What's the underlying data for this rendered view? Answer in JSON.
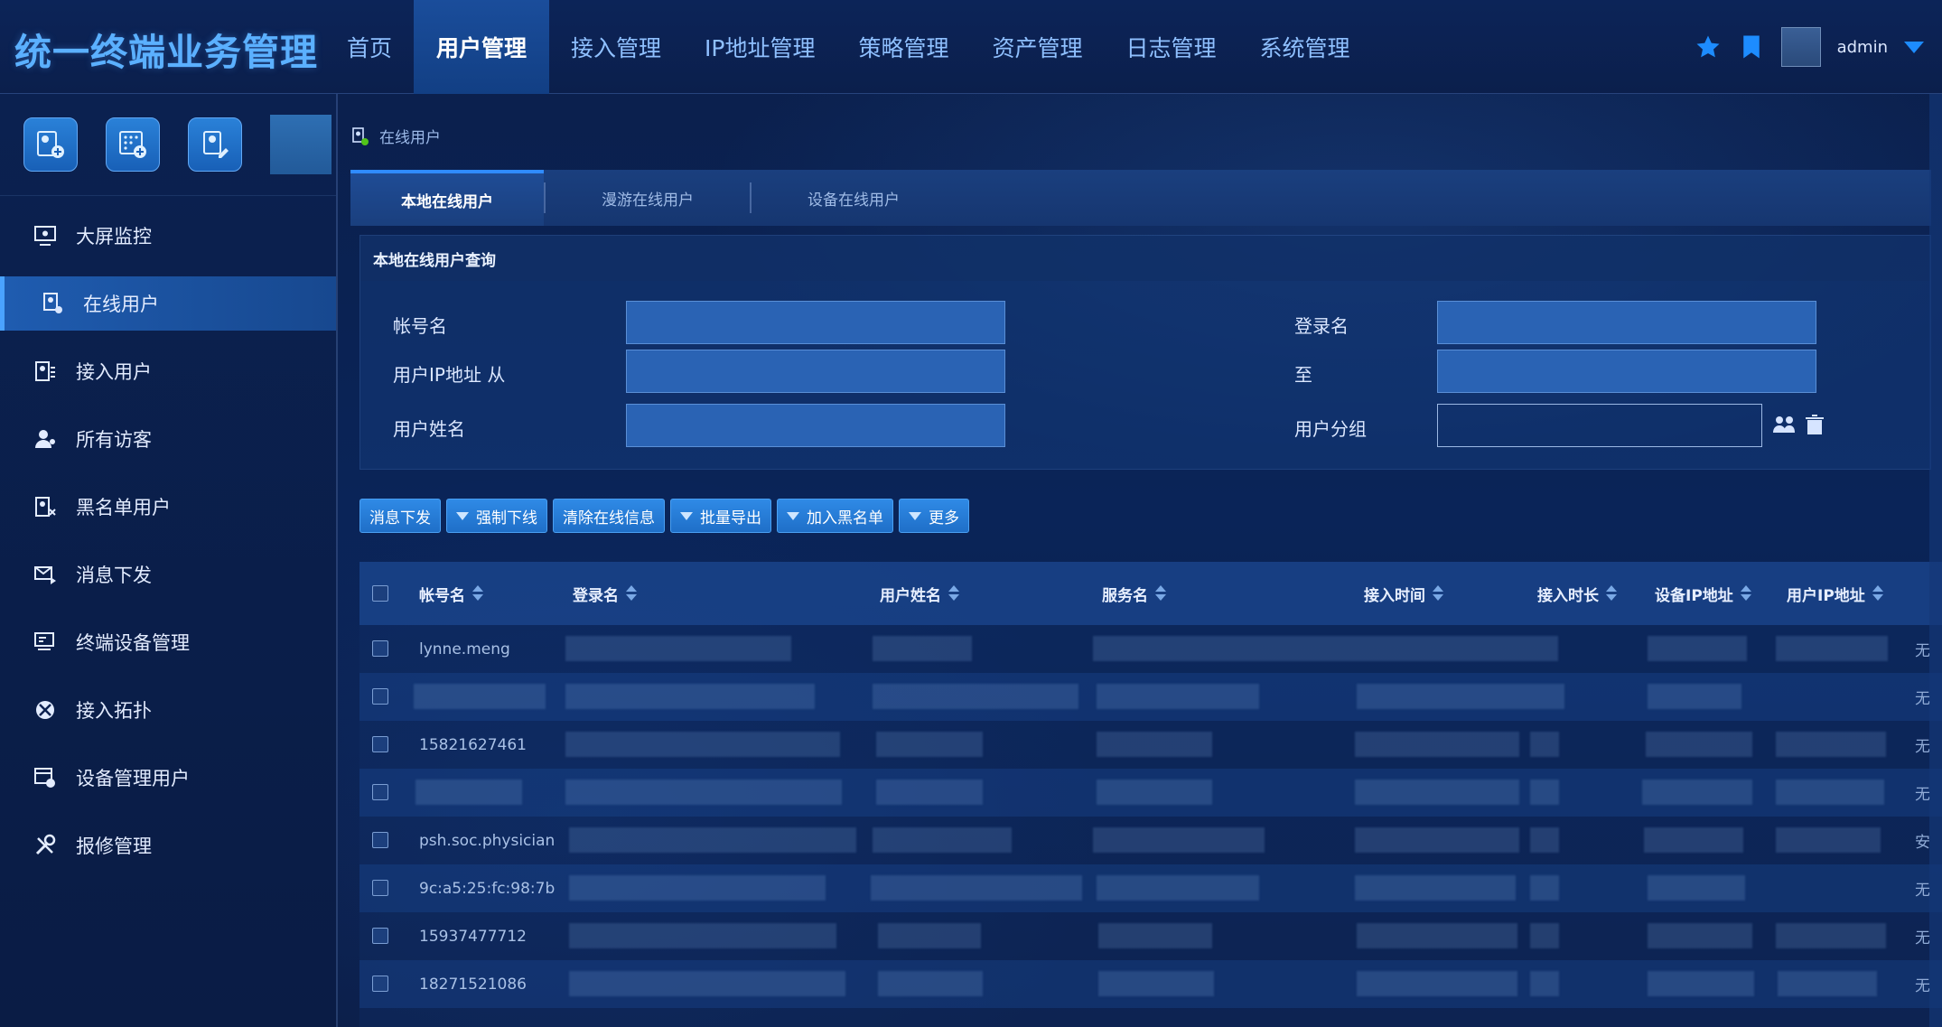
{
  "app_title": "统一终端业务管理",
  "nav": [
    {
      "label": "首页",
      "active": false
    },
    {
      "label": "用户管理",
      "active": true
    },
    {
      "label": "接入管理",
      "active": false
    },
    {
      "label": "IP地址管理",
      "active": false
    },
    {
      "label": "策略管理",
      "active": false
    },
    {
      "label": "资产管理",
      "active": false
    },
    {
      "label": "日志管理",
      "active": false
    },
    {
      "label": "系统管理",
      "active": false
    }
  ],
  "header": {
    "user": "admin"
  },
  "sidebar": {
    "items": [
      {
        "label": "大屏监控",
        "icon": "monitor-icon"
      },
      {
        "label": "在线用户",
        "icon": "online-user-icon",
        "active": true
      },
      {
        "label": "接入用户",
        "icon": "access-user-icon"
      },
      {
        "label": "所有访客",
        "icon": "visitor-icon"
      },
      {
        "label": "黑名单用户",
        "icon": "blacklist-icon"
      },
      {
        "label": "消息下发",
        "icon": "message-icon"
      },
      {
        "label": "终端设备管理",
        "icon": "terminal-device-icon"
      },
      {
        "label": "接入拓扑",
        "icon": "topology-icon"
      },
      {
        "label": "设备管理用户",
        "icon": "device-admin-icon"
      },
      {
        "label": "报修管理",
        "icon": "repair-icon"
      }
    ]
  },
  "breadcrumb": "在线用户",
  "tabs": [
    "本地在线用户",
    "漫游在线用户",
    "设备在线用户"
  ],
  "query": {
    "title": "本地在线用户查询",
    "account_label": "帐号名",
    "login_label": "登录名",
    "ip_from_label": "用户IP地址 从",
    "ip_to_label": "至",
    "name_label": "用户姓名",
    "group_label": "用户分组"
  },
  "toolbar": [
    {
      "label": "消息下发",
      "dropdown": false
    },
    {
      "label": "强制下线",
      "dropdown": true
    },
    {
      "label": "清除在线信息",
      "dropdown": false
    },
    {
      "label": "批量导出",
      "dropdown": true
    },
    {
      "label": "加入黑名单",
      "dropdown": true
    },
    {
      "label": "更多",
      "dropdown": true
    }
  ],
  "table": {
    "columns": [
      "帐号名",
      "登录名",
      "用户姓名",
      "服务名",
      "接入时间",
      "接入时长",
      "设备IP地址",
      "用户IP地址"
    ],
    "rows": [
      {
        "account": "lynne.meng",
        "tail": "无"
      },
      {
        "account": "",
        "tail": "无"
      },
      {
        "account": "15821627461",
        "tail": "无"
      },
      {
        "account": "",
        "tail": "无"
      },
      {
        "account": "psh.soc.physician",
        "tail": "安"
      },
      {
        "account": "9c:a5:25:fc:98:7b",
        "tail": "无"
      },
      {
        "account": "15937477712",
        "tail": "无"
      },
      {
        "account": "18271521086",
        "tail": "无"
      }
    ]
  }
}
